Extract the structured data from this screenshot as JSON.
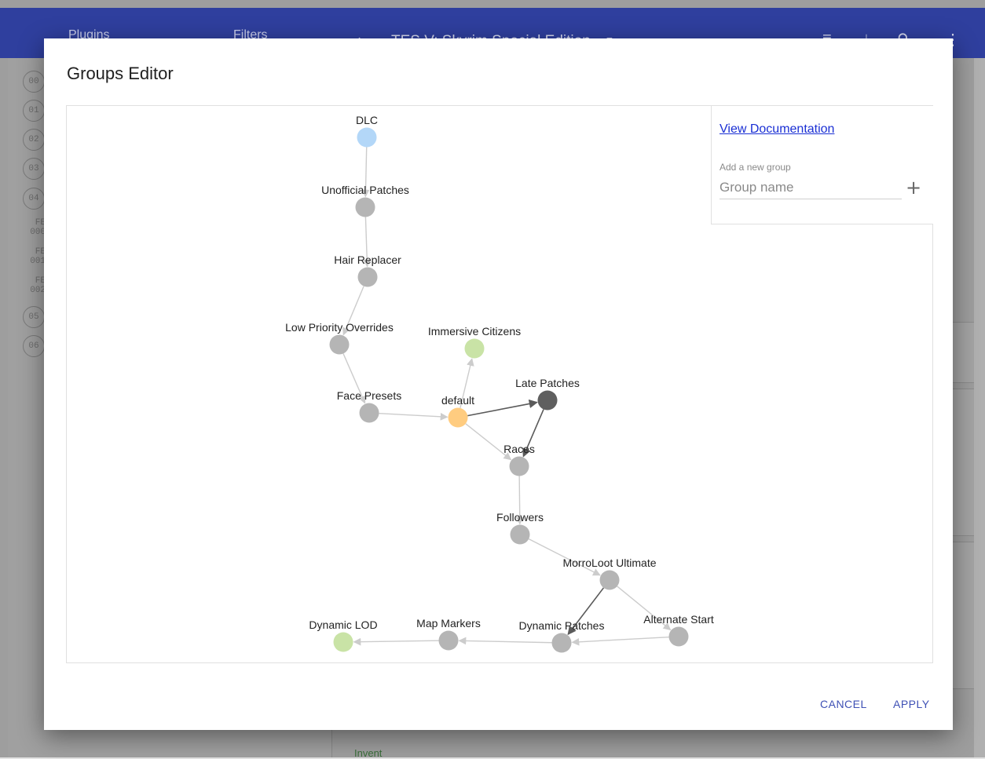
{
  "background_app": {
    "tabs": [
      "Plugins",
      "Filters"
    ],
    "game_title": "TES V: Skyrim Special Edition",
    "plugin_indices": [
      "00",
      "01",
      "02",
      "03",
      "04",
      "FE 000",
      "FE 001",
      "FE 002",
      "05",
      "06"
    ],
    "footer_text": "Invent"
  },
  "dialog": {
    "title": "Groups Editor",
    "documentation_link": "View Documentation",
    "add_group_label": "Add a new group",
    "group_name_placeholder": "Group name",
    "cancel_label": "CANCEL",
    "apply_label": "APPLY"
  },
  "colors": {
    "header_blue": "#2f3f9e",
    "accent": "#3f51b5",
    "node_default_grey": "#b5b5b5",
    "node_dlc_blue": "#b3d7f8",
    "node_plugin_green": "#c9e3a6",
    "node_default_orange": "#ffcc80",
    "node_late_patches": "#5f5f5f",
    "edge_light": "#cccccc",
    "edge_dark": "#5a5a5a"
  },
  "graph": {
    "nodes": [
      {
        "id": "dlc",
        "label": "DLC",
        "color": "#b3d7f8"
      },
      {
        "id": "unofficial",
        "label": "Unofficial Patches",
        "color": "#b5b5b5"
      },
      {
        "id": "hair",
        "label": "Hair Replacer",
        "color": "#b5b5b5"
      },
      {
        "id": "lowpri",
        "label": "Low Priority Overrides",
        "color": "#b5b5b5"
      },
      {
        "id": "face",
        "label": "Face Presets",
        "color": "#b5b5b5"
      },
      {
        "id": "immersive",
        "label": "Immersive Citizens",
        "color": "#c9e3a6"
      },
      {
        "id": "default",
        "label": "default",
        "color": "#ffcc80"
      },
      {
        "id": "late",
        "label": "Late Patches",
        "color": "#5f5f5f"
      },
      {
        "id": "races",
        "label": "Races",
        "color": "#b5b5b5"
      },
      {
        "id": "followers",
        "label": "Followers",
        "color": "#b5b5b5"
      },
      {
        "id": "morroloot",
        "label": "MorroLoot Ultimate",
        "color": "#b5b5b5"
      },
      {
        "id": "alternate",
        "label": "Alternate Start",
        "color": "#b5b5b5"
      },
      {
        "id": "dynpatch",
        "label": "Dynamic Patches",
        "color": "#b5b5b5"
      },
      {
        "id": "mapmarkers",
        "label": "Map Markers",
        "color": "#b5b5b5"
      },
      {
        "id": "dynlod",
        "label": "Dynamic LOD",
        "color": "#c9e3a6"
      }
    ],
    "edges": [
      {
        "from": "dlc",
        "to": "unofficial",
        "style": "light"
      },
      {
        "from": "unofficial",
        "to": "hair",
        "style": "light"
      },
      {
        "from": "hair",
        "to": "lowpri",
        "style": "light"
      },
      {
        "from": "lowpri",
        "to": "face",
        "style": "light"
      },
      {
        "from": "face",
        "to": "default",
        "style": "light"
      },
      {
        "from": "default",
        "to": "immersive",
        "style": "light"
      },
      {
        "from": "default",
        "to": "late",
        "style": "dark"
      },
      {
        "from": "default",
        "to": "races",
        "style": "light"
      },
      {
        "from": "late",
        "to": "races",
        "style": "dark"
      },
      {
        "from": "races",
        "to": "followers",
        "style": "light"
      },
      {
        "from": "followers",
        "to": "morroloot",
        "style": "light"
      },
      {
        "from": "morroloot",
        "to": "dynpatch",
        "style": "dark"
      },
      {
        "from": "morroloot",
        "to": "alternate",
        "style": "light"
      },
      {
        "from": "alternate",
        "to": "dynpatch",
        "style": "light"
      },
      {
        "from": "dynpatch",
        "to": "mapmarkers",
        "style": "light"
      },
      {
        "from": "mapmarkers",
        "to": "dynlod",
        "style": "light"
      }
    ]
  },
  "icons": {
    "home": "home-icon",
    "sort": "sort-icon",
    "download": "download-icon",
    "search": "search-icon",
    "more": "more-vert-icon",
    "add": "plus-icon"
  }
}
